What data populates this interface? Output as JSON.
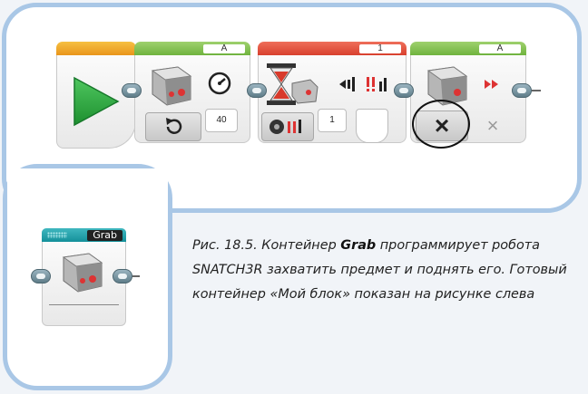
{
  "program": {
    "start_block": {
      "icon": "play-triangle-icon"
    },
    "motor_block": {
      "port": "A",
      "mode_icon": "speedometer-icon",
      "reset_icon": "rotate-icon",
      "power": "40"
    },
    "wait_block": {
      "port": "1",
      "sensor_icon": "infrared-sensor-icon",
      "compare_icon": "compare-icon",
      "value": "1"
    },
    "stop_block": {
      "port": "A",
      "brake_value": "×",
      "brake_disabled": "×"
    }
  },
  "my_block": {
    "label": "Grab"
  },
  "caption": {
    "prefix": "Рис. 18.5. Контейнер ",
    "bold": "Grab",
    "text": " программирует робота SNATCH3R захватить предмет и поднять его. Готовый контейнер «Мой блок» показан на рисунке слева"
  },
  "colors": {
    "frame": "#a9c7e6",
    "start_bar": "#f0a928",
    "motor_bar": "#8cc85a",
    "wait_bar": "#e4513d",
    "mybock_bar": "#1ea3ac"
  }
}
